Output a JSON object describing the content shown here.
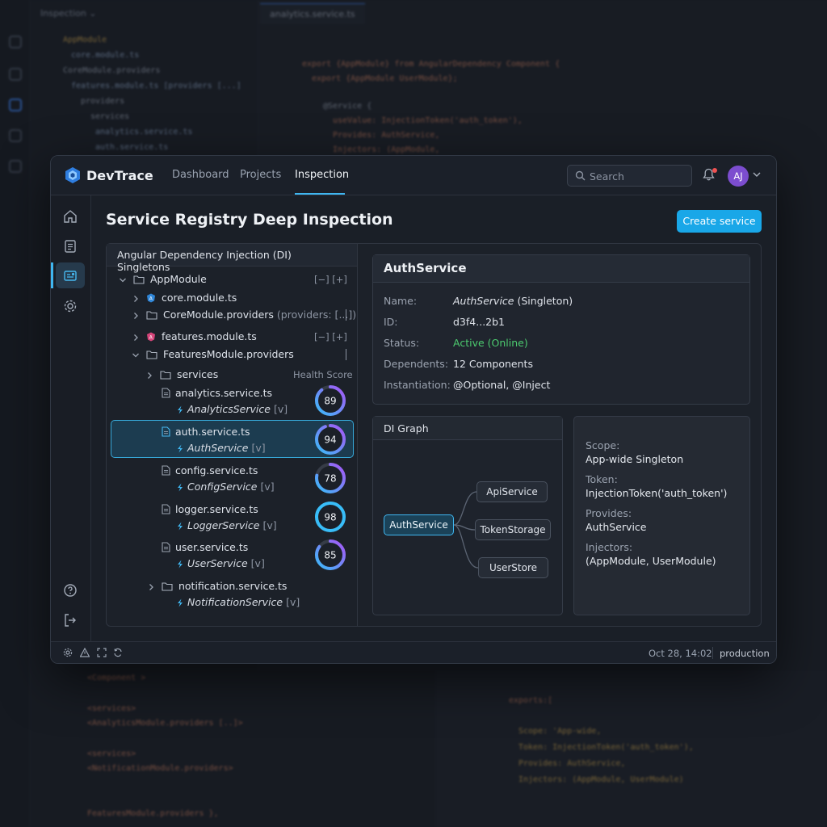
{
  "background": {
    "explorer_title": "Inspection ⌄",
    "explorer_lines": [
      "AppModule",
      "core.module.ts",
      "CoreModule.providers",
      "features.module.ts [providers [...]",
      "providers",
      "services",
      "analytics.service.ts",
      "auth.service.ts"
    ],
    "editor_tab": "analytics.service.ts",
    "code_lines": [
      "export {AppModule} from AngularDependency Component {",
      "export {AppModule UserModule};",
      "@Service {",
      "useValue: InjectionToken('auth_token'),",
      "Provides: AuthService,",
      "Injectors: (AppModule,"
    ],
    "bottom_lines": [
      "<Component >",
      "<services>",
      "<AnalyticsModule.providers [..]>",
      "<services>",
      "<NotificationModule.providers>",
      "FeaturesModule.providers },"
    ],
    "bottom_right_lines": [
      "exports:[",
      "Scope: 'App-wide,",
      "Token: InjectionToken('auth_token'),",
      "Provides: AuthService,",
      "Injectors: (AppModule, UserModule)"
    ]
  },
  "app": {
    "brand": "DevTrace",
    "nav": [
      "Dashboard",
      "Projects",
      "Inspection"
    ],
    "active_nav": "Inspection",
    "search_placeholder": "Search",
    "avatar_initials": "AJ",
    "accent": "#19a7e8"
  },
  "page": {
    "title": "Service Registry Deep Inspection",
    "create_button": "Create service"
  },
  "tree": {
    "header": "Angular Dependency Injection (DI) Singletons",
    "app_module": "AppModule",
    "app_module_actions": "[−] [+]",
    "core_module": "core.module.ts",
    "core_providers": "CoreModule.providers",
    "core_providers_suffix": "(providers: [...])",
    "features_module": "features.module.ts",
    "features_actions": "[−] [+]",
    "features_providers": "FeaturesModule.providers",
    "services_folder": "services",
    "health_score_label": "Health Score",
    "services": [
      {
        "file": "analytics.service.ts",
        "name": "AnalyticsService",
        "tag": "[v]",
        "score": 89
      },
      {
        "file": "auth.service.ts",
        "name": "AuthService",
        "tag": "[v]",
        "score": 94
      },
      {
        "file": "config.service.ts",
        "name": "ConfigService",
        "tag": "[v]",
        "score": 78
      },
      {
        "file": "logger.service.ts",
        "name": "LoggerService",
        "tag": "[v]",
        "score": 98
      },
      {
        "file": "user.service.ts",
        "name": "UserService",
        "tag": "[v]",
        "score": 85
      }
    ],
    "notification_file": "notification.service.ts",
    "notification_name": "NotificationService",
    "notification_tag": "[v]"
  },
  "details": {
    "title": "AuthService",
    "name_label": "Name:",
    "name_value": "AuthService",
    "name_suffix": "(Singleton)",
    "id_label": "ID:",
    "id_value": "d3f4...2b1",
    "status_label": "Status:",
    "status_value": "Active (Online)",
    "dependents_label": "Dependents:",
    "dependents_value": "12 Components",
    "instantiation_label": "Instantiation:",
    "instantiation_value": "@Optional, @Inject"
  },
  "graph": {
    "title": "DI Graph",
    "root": "AuthService",
    "children": [
      "ApiService",
      "TokenStorage",
      "UserStore"
    ]
  },
  "info": {
    "scope_label": "Scope:",
    "scope_value": "App-wide Singleton",
    "token_label": "Token:",
    "token_value": "InjectionToken('auth_token')",
    "provides_label": "Provides:",
    "provides_value": "AuthService",
    "injectors_label": "Injectors:",
    "injectors_value": "(AppModule, UserModule)"
  },
  "status": {
    "timestamp": "Oct 28, 14:02",
    "environment": "production"
  }
}
